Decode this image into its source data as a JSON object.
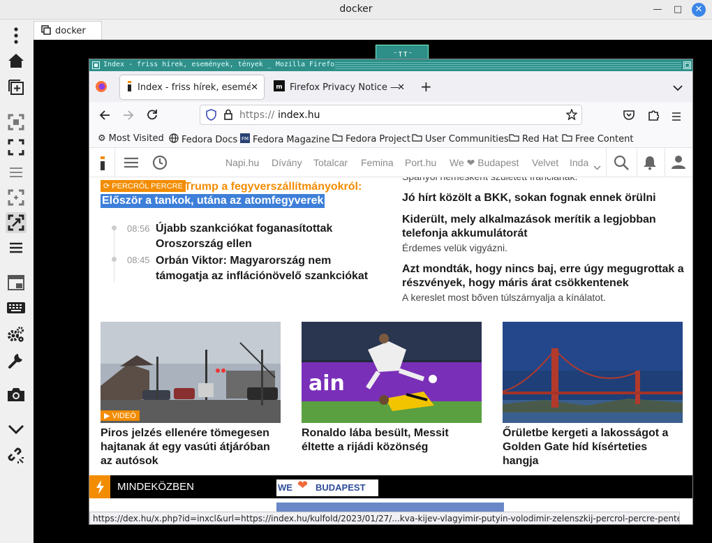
{
  "window": {
    "title": "docker"
  },
  "viewer_tab": {
    "label": "docker"
  },
  "firefox": {
    "title_bar": "Index - friss hírek, események, tények _ Mozilla Firefox",
    "tabs": [
      {
        "label": "Index - friss hírek, esemény"
      },
      {
        "label": "Firefox Privacy Notice — M"
      }
    ],
    "url_scheme": "https://",
    "url_host": "index.hu",
    "bookmarks": [
      "Most Visited",
      "Fedora Docs",
      "Fedora Magazine",
      "Fedora Project",
      "User Communities",
      "Red Hat",
      "Free Content"
    ],
    "status_url": "https://dex.hu/x.php?id=inxcl&url=https://index.hu/kulfold/2023/01/27/...kva-kijev-vlagyimir-putyin-volodimir-zelenszkij-percrol-percre-pentek/"
  },
  "site_nav": {
    "links": [
      "Napi.hu",
      "Dívány",
      "Totalcar",
      "Femina",
      "Port.hu",
      "We ❤ Budapest",
      "Velvet",
      "Inda"
    ]
  },
  "live": {
    "badge": "PERCRŐL PERCRE",
    "headline_a": "Trump a fegyverszállítmányokról:",
    "headline_b": "Először a tankok, utána az atomfegyverek",
    "items": [
      {
        "time": "08:56",
        "text_a": "Újabb szankciókat foganasítottak",
        "text_b": "Oroszország ellen"
      },
      {
        "time": "08:45",
        "text_a": "Orbán Viktor: Magyarország nem",
        "text_b": "támogatja az inflációnövelő szankciókat"
      }
    ]
  },
  "right_col": {
    "cut_text": "Spanyol nemesként született franciának.",
    "stories": [
      {
        "title_a": "Jó hírt közölt a BKK, sokan fognak ennek örülni",
        "title_b": "",
        "lead": ""
      },
      {
        "title_a": "Kiderült, mely alkalmazások merítik a legjobban",
        "title_b": "telefonja akkumulátorát",
        "lead": "Érdemes velük vigyázni."
      },
      {
        "title_a": "Azt mondták, hogy nincs baj, erre úgy megugrottak a",
        "title_b": "részvények, hogy máris árat csökkentenek",
        "lead": "A kereslet most bőven túlszárnyalja a kínálatot."
      }
    ]
  },
  "cards": [
    {
      "badge": "VIDEÓ",
      "l1": "Piros jelzés ellenére tömegesen",
      "l2": "hajtanak át egy vasúti átjáróban",
      "l3": "az autósok"
    },
    {
      "badge": "",
      "l1": "Ronaldo lába besült, Messit",
      "l2": "éltette a rijádi közönség",
      "l3": ""
    },
    {
      "badge": "",
      "l1": "Őrületbe kergeti a lakosságot a",
      "l2": "Golden Gate híd kísérteties",
      "l3": "hangja"
    }
  ],
  "bottom": {
    "section": "MINDEKÖZBEN",
    "ad_we": "WE",
    "ad_city": "BUDAPEST"
  },
  "colors": {
    "accent_orange": "#f28c00",
    "highlight_blue": "#3d7fd9",
    "teal": "#2f8f89"
  }
}
